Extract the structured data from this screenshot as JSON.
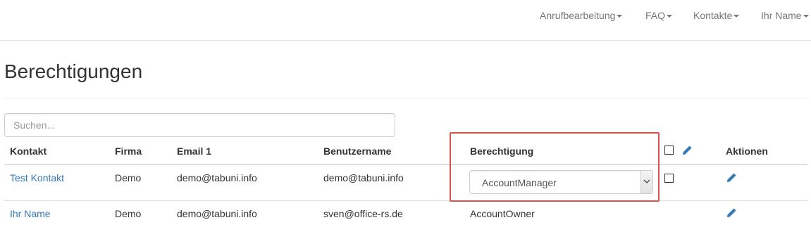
{
  "nav": {
    "items": [
      {
        "label": "Anrufbearbeitung"
      },
      {
        "label": "FAQ"
      },
      {
        "label": "Kontakte"
      },
      {
        "label": "Ihr Name"
      }
    ]
  },
  "page": {
    "title": "Berechtigungen"
  },
  "search": {
    "placeholder": "Suchen...",
    "value": ""
  },
  "table": {
    "headers": {
      "contact": "Kontakt",
      "company": "Firma",
      "email": "Email 1",
      "username": "Benutzername",
      "permission": "Berechtigung",
      "actions": "Aktionen"
    },
    "rows": [
      {
        "contact": "Test Kontakt",
        "company": "Demo",
        "email": "demo@tabuni.info",
        "username": "demo@tabuni.info",
        "permission": "AccountManager",
        "permission_editable": true,
        "checked": false
      },
      {
        "contact": "Ihr Name",
        "company": "Demo",
        "email": "demo@tabuni.info",
        "username": "sven@office-rs.de",
        "permission": "AccountOwner",
        "permission_editable": false
      }
    ]
  },
  "icons": {
    "edit": "pencil-icon",
    "dropdown": "chevron-down-icon",
    "caret": "caret-down-icon"
  },
  "colors": {
    "link": "#337ab7",
    "nav_text": "#777777",
    "highlight": "#d9534f"
  }
}
